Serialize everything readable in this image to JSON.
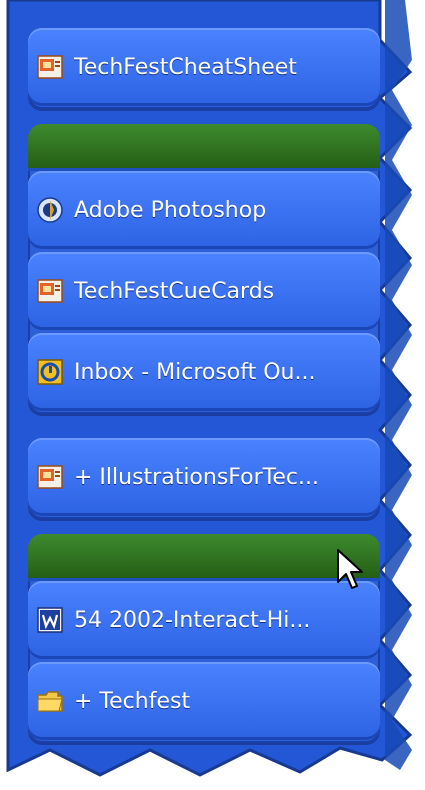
{
  "items": {
    "techfest_cheatsheet": {
      "label": "TechFestCheatSheet",
      "icon": "powerpoint-icon"
    },
    "adobe_photoshop": {
      "label": "Adobe Photoshop",
      "icon": "photoshop-icon"
    },
    "techfest_cuecards": {
      "label": "TechFestCueCards",
      "icon": "powerpoint-icon"
    },
    "inbox_outlook": {
      "label": "Inbox - Microsoft Ou...",
      "icon": "outlook-icon"
    },
    "illustrations": {
      "label": "+ IllustrationsForTec...",
      "icon": "powerpoint-icon"
    },
    "interact_doc": {
      "label": "54 2002-Interact-Hi...",
      "icon": "word-icon"
    },
    "techfest_folder": {
      "label": "+ Techfest",
      "icon": "folder-icon"
    }
  },
  "colors": {
    "panel_blue": "#2457d6",
    "group_header_green": "#2f7020",
    "item_blue": "#3a72f0"
  }
}
